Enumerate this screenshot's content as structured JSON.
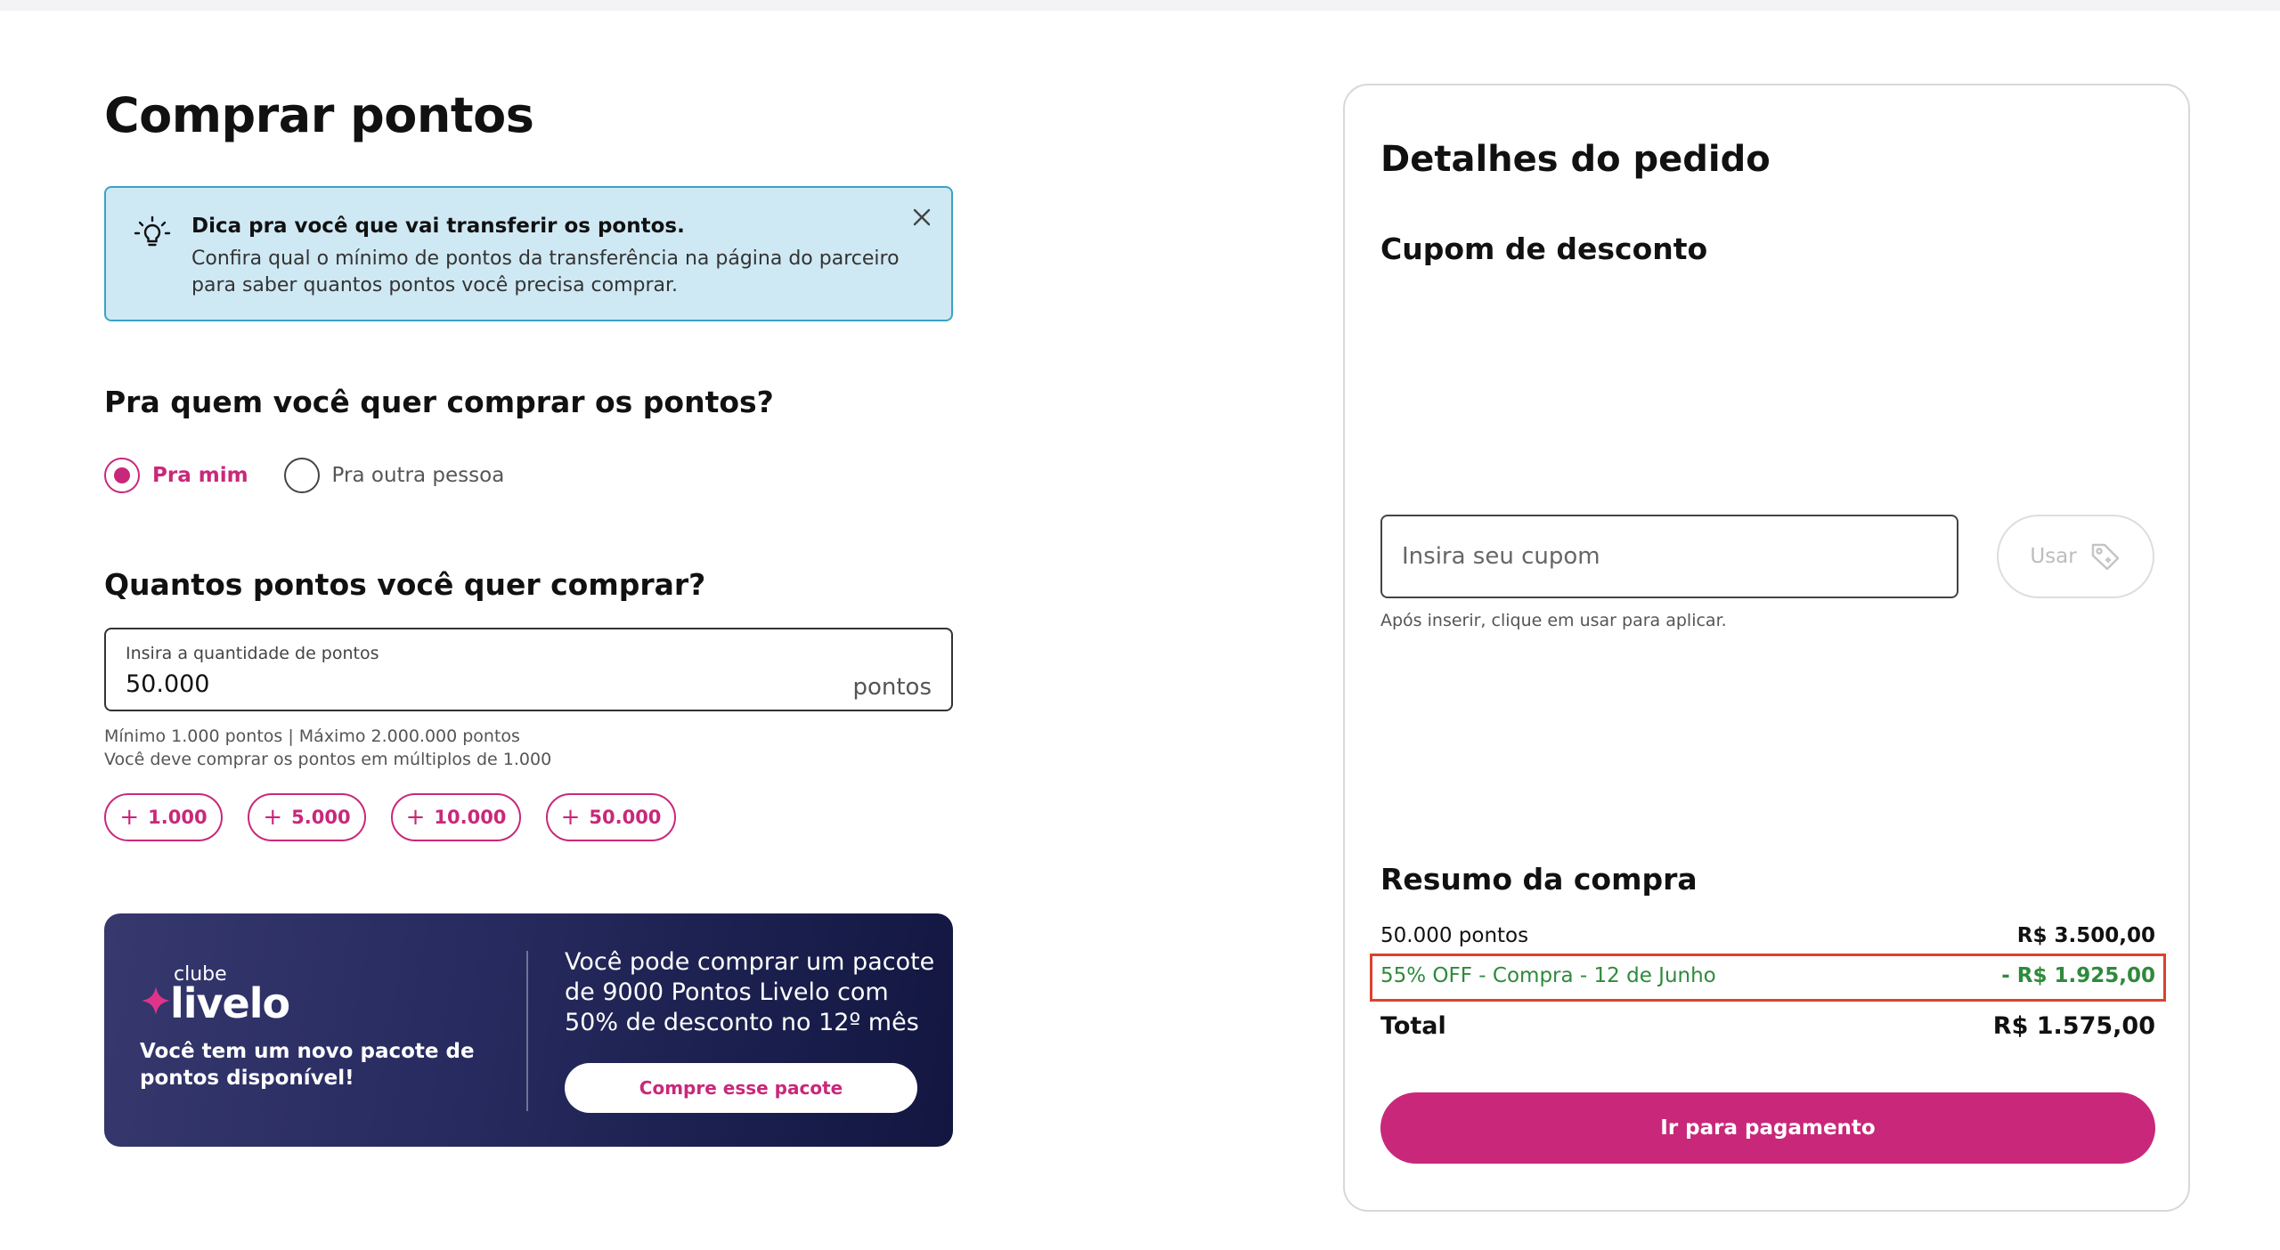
{
  "page": {
    "title": "Comprar pontos"
  },
  "tip": {
    "title": "Dica pra você que vai transferir os pontos.",
    "text": "Confira qual o mínimo de pontos da transferência na página do parceiro para saber quantos pontos você precisa comprar.",
    "icon": "lightbulb-icon",
    "close_icon": "close-icon"
  },
  "recipient": {
    "question": "Pra quem você quer comprar os pontos?",
    "options": [
      {
        "label": "Pra mim",
        "selected": true
      },
      {
        "label": "Pra outra pessoa",
        "selected": false
      }
    ]
  },
  "quantity": {
    "question": "Quantos pontos você quer comprar?",
    "field_label": "Insira a quantidade de pontos",
    "value": "50.000",
    "unit": "pontos",
    "hint_line1": "Mínimo 1.000 pontos | Máximo 2.000.000 pontos",
    "hint_line2": "Você deve comprar os pontos em múltiplos de 1.000",
    "chips": [
      "1.000",
      "5.000",
      "10.000",
      "50.000"
    ]
  },
  "promo": {
    "club_label": "clube",
    "brand": "livelo",
    "left_text": "Você tem um novo pacote de pontos disponível!",
    "text": "Você pode comprar um pacote de 9000 Pontos Livelo com 50% de desconto no 12º mês",
    "button": "Compre esse pacote"
  },
  "order": {
    "title": "Detalhes do pedido",
    "coupon_title": "Cupom de desconto",
    "coupon_placeholder": "Insira seu cupom",
    "coupon_value": "",
    "use_button": "Usar",
    "coupon_hint": "Após inserir, clique em usar para aplicar.",
    "summary_title": "Resumo da compra",
    "items": [
      {
        "label": "50.000 pontos",
        "value": "R$ 3.500,00"
      },
      {
        "label": "55% OFF - Compra - 12 de Junho",
        "value": "- R$ 1.925,00"
      }
    ],
    "total_label": "Total",
    "total_value": "R$ 1.575,00",
    "pay_button": "Ir para pagamento"
  },
  "colors": {
    "accent": "#c9287a",
    "discount": "#2e8a3c",
    "tip_bg": "#cfe9f4",
    "promo_bg": "#262a5e",
    "highlight": "#d9432f"
  }
}
